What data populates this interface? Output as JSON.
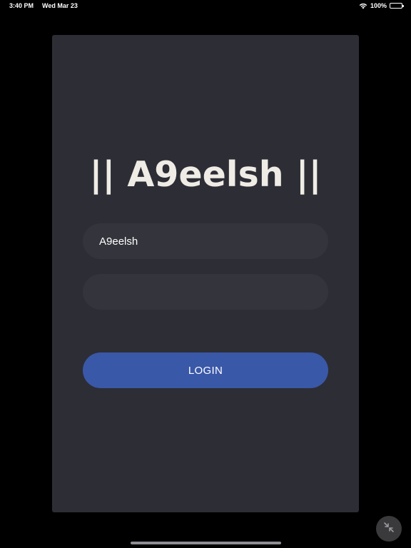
{
  "status_bar": {
    "time": "3:40 PM",
    "date": "Wed Mar 23",
    "battery_percent": "100%",
    "battery_level": 1.0,
    "icons": [
      "wifi-icon",
      "battery-icon"
    ]
  },
  "app": {
    "title": "|| A9eelsh ||"
  },
  "form": {
    "username_value": "A9eelsh",
    "password_value": "",
    "login_label": "LOGIN"
  },
  "controls": {
    "collapse_icon": "collapse-arrows-icon"
  },
  "colors": {
    "background": "#000000",
    "card": "#2d2d35",
    "input": "#34343c",
    "accent": "#3a58a8",
    "title": "#efece6"
  }
}
